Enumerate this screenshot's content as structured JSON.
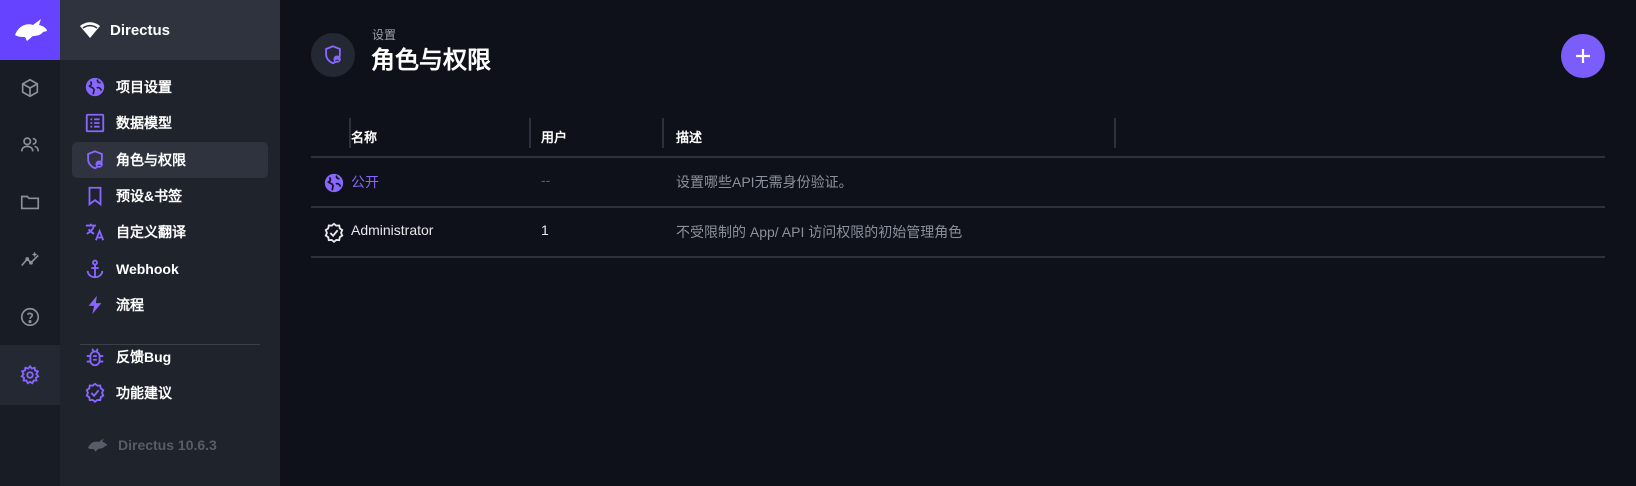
{
  "module_bar": {
    "items": [
      {
        "name": "content-module",
        "icon": "cube-icon"
      },
      {
        "name": "users-module",
        "icon": "users-icon"
      },
      {
        "name": "files-module",
        "icon": "folder-icon"
      },
      {
        "name": "insights-module",
        "icon": "insights-icon"
      },
      {
        "name": "docs-module",
        "icon": "help-icon"
      },
      {
        "name": "settings-module",
        "icon": "gear-icon",
        "active": true
      }
    ]
  },
  "project": {
    "name": "Directus"
  },
  "nav": {
    "items": [
      {
        "label": "项目设置",
        "icon": "globe-icon"
      },
      {
        "label": "数据模型",
        "icon": "list-alt-icon"
      },
      {
        "label": "角色与权限",
        "icon": "shield-icon",
        "active": true
      },
      {
        "label": "预设&书签",
        "icon": "bookmark-icon"
      },
      {
        "label": "自定义翻译",
        "icon": "translate-icon"
      },
      {
        "label": "Webhook",
        "icon": "anchor-icon"
      },
      {
        "label": "流程",
        "icon": "bolt-icon"
      },
      {
        "label": "反馈Bug",
        "icon": "bug-icon"
      },
      {
        "label": "功能建议",
        "icon": "verified-icon"
      }
    ],
    "version": "Directus 10.6.3"
  },
  "header": {
    "breadcrumb": "设置",
    "title": "角色与权限"
  },
  "table": {
    "columns": [
      "名称",
      "用户",
      "描述"
    ],
    "rows": [
      {
        "icon": "public-icon",
        "name": "公开",
        "users": "--",
        "description": "设置哪些API无需身份验证。"
      },
      {
        "icon": "verified-icon",
        "name": "Administrator",
        "users": "1",
        "description": "不受限制的 App/ API 访问权限的初始管理角色"
      }
    ]
  },
  "colors": {
    "accent": "#6644ff",
    "accent_light": "#8866ff",
    "background": "#0e1119",
    "nav_background": "#1f232c"
  }
}
